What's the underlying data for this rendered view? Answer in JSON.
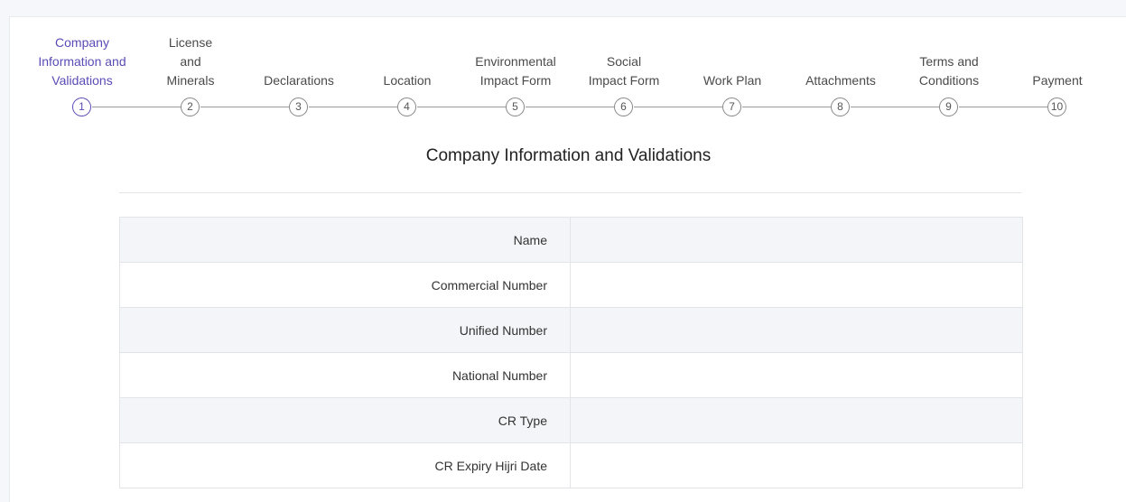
{
  "steps": [
    {
      "label": "Company\nInformation and\nValidations",
      "number": "1"
    },
    {
      "label": "License\nand\nMinerals",
      "number": "2"
    },
    {
      "label": "Declarations",
      "number": "3"
    },
    {
      "label": "Location",
      "number": "4"
    },
    {
      "label": "Environmental\nImpact Form",
      "number": "5"
    },
    {
      "label": "Social\nImpact Form",
      "number": "6"
    },
    {
      "label": "Work Plan",
      "number": "7"
    },
    {
      "label": "Attachments",
      "number": "8"
    },
    {
      "label": "Terms and\nConditions",
      "number": "9"
    },
    {
      "label": "Payment",
      "number": "10"
    }
  ],
  "section": {
    "title": "Company Information and Validations"
  },
  "fields": [
    {
      "label": "Name",
      "value": ""
    },
    {
      "label": "Commercial Number",
      "value": ""
    },
    {
      "label": "Unified Number",
      "value": ""
    },
    {
      "label": "National Number",
      "value": ""
    },
    {
      "label": "CR Type",
      "value": ""
    },
    {
      "label": "CR Expiry Hijri Date",
      "value": ""
    }
  ],
  "colors": {
    "accent": "#5a4bb5",
    "row_shade": "#f4f5f8"
  }
}
